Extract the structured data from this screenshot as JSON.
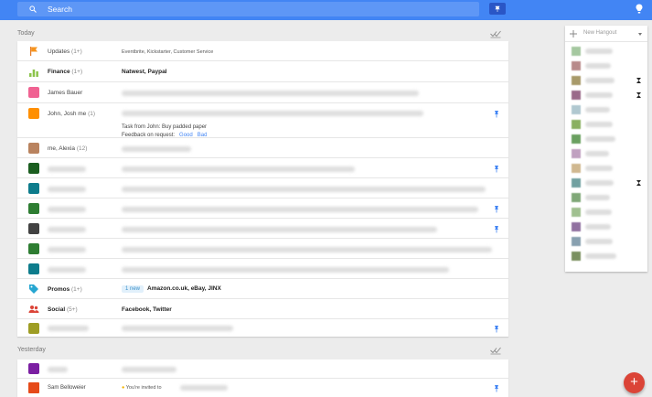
{
  "header": {
    "search_placeholder": "Search"
  },
  "sections": {
    "today": "Today",
    "yesterday": "Yesterday"
  },
  "colors": {
    "header": "#4285f4",
    "fab": "#db4437"
  },
  "rows": [
    {
      "sender": "Updates",
      "count": "(1+)",
      "subject": "Eventbrite, Kickstarter, Customer Service"
    },
    {
      "sender": "Finance",
      "count": "(1+)",
      "subject": "Natwest, Paypal"
    },
    {
      "sender": "James Bauer"
    },
    {
      "sender": "John, Josh me",
      "count": "(1)",
      "task_line": "Task from John: Buy padded paper",
      "feedback_label": "Feedback on request:",
      "good": "Good",
      "bad": "Bad"
    },
    {
      "sender": "me, Alexia",
      "count": "(12)"
    },
    {
      "sender": "Promos",
      "count": "(1+)",
      "badge": "1 new",
      "subject": "Amazon.co.uk, eBay, JINX"
    },
    {
      "sender": "Social",
      "count": "(5+)",
      "subject": "Facebook, Twitter"
    },
    {
      "sender": "Sam Belloweier",
      "subject": "You're invited to"
    }
  ],
  "hangouts": {
    "title": "New Hangout"
  },
  "fab": {
    "label": "+"
  },
  "icons": [
    "search-icon",
    "pin-icon",
    "lightbulb-icon",
    "flag-icon",
    "chart-icon",
    "check-all-icon",
    "tag-icon",
    "people-icon",
    "plus-icon",
    "video-icon"
  ]
}
